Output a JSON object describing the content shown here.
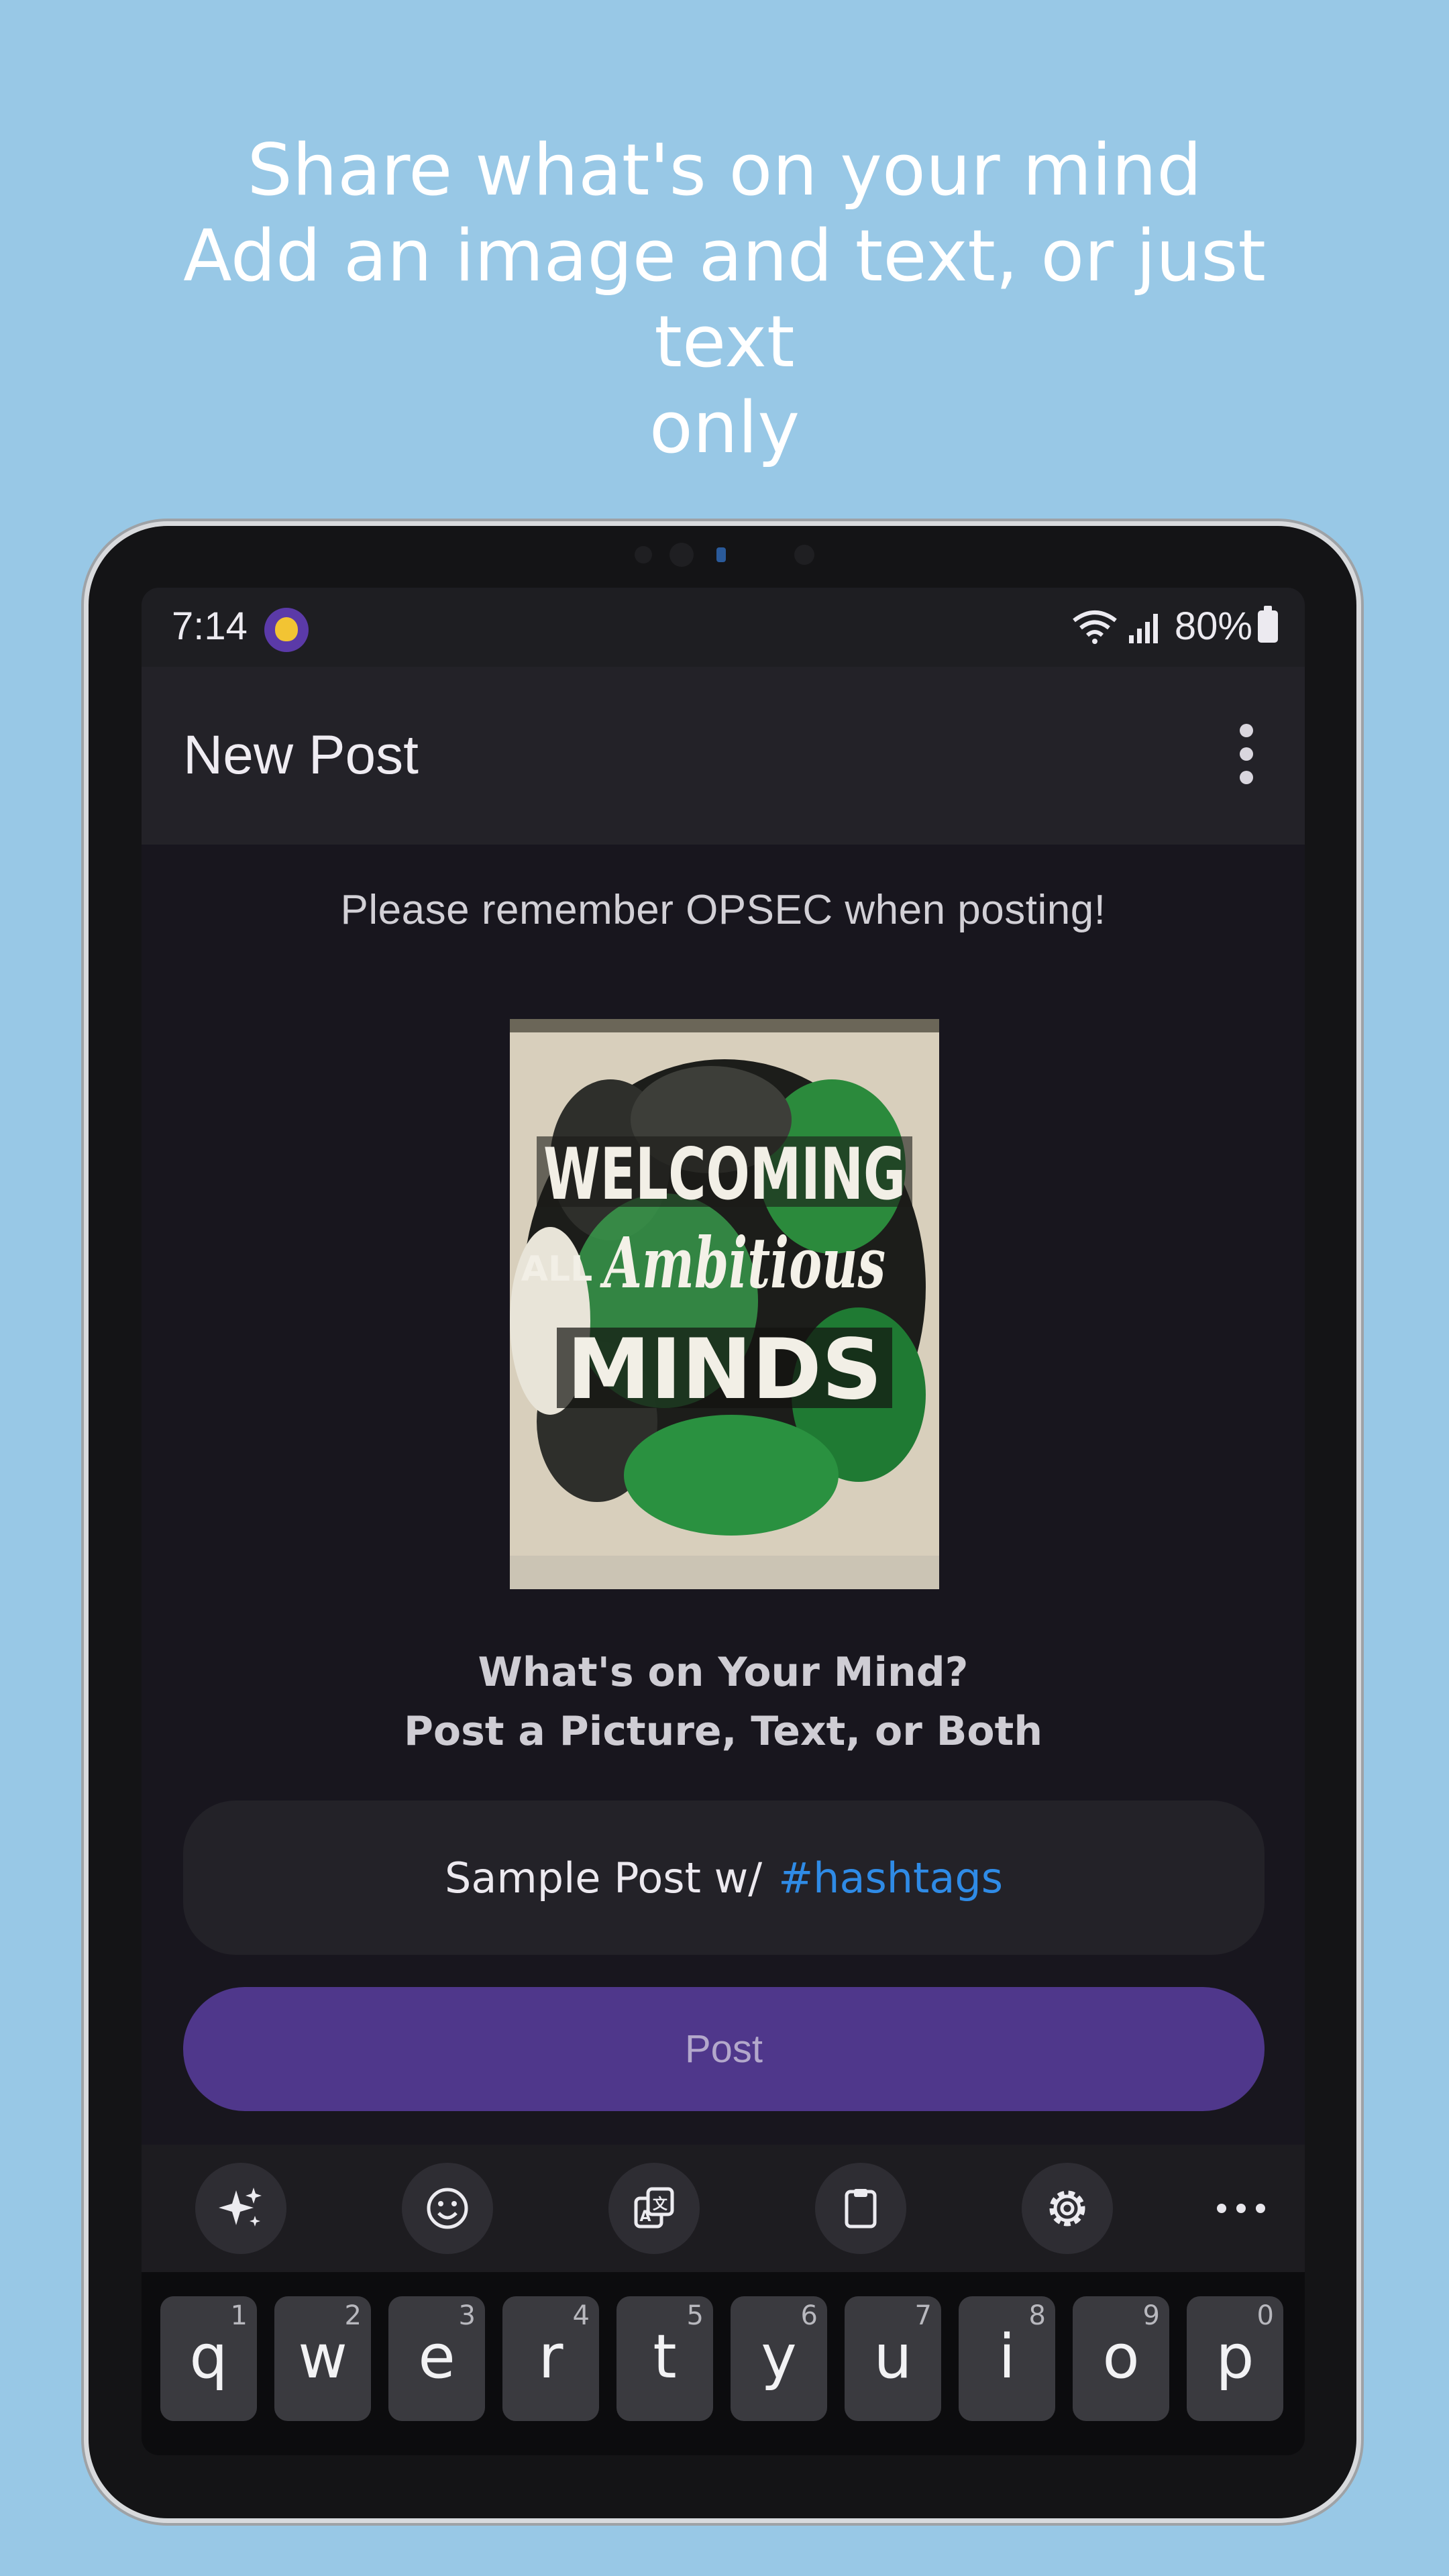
{
  "promo": {
    "line1": "Share what's on your mind",
    "line2": "Add an image and text, or just text",
    "line3": "only"
  },
  "status_bar": {
    "time": "7:14",
    "battery": "80%",
    "icons": [
      "app-badge-icon",
      "wifi-icon",
      "signal-icon",
      "battery-icon"
    ]
  },
  "app_bar": {
    "title": "New Post",
    "menu_icon": "more-vert-icon"
  },
  "notice": "Please remember OPSEC when posting!",
  "image": {
    "words": [
      "WELCOMING",
      "ALL",
      "Ambitious",
      "MINDS"
    ]
  },
  "prompt": {
    "line1": "What's on Your Mind?",
    "line2": "Post a Picture, Text, or Both"
  },
  "text_field": {
    "value": "Sample Post w/",
    "hashtag": "#hashtags"
  },
  "post_button": "Post",
  "keyboard": {
    "toolbar": [
      "sparkle-icon",
      "emoji-icon",
      "translate-icon",
      "clipboard-icon",
      "settings-icon",
      "more-horiz-icon"
    ],
    "keys": [
      {
        "letter": "q",
        "hint": "1"
      },
      {
        "letter": "w",
        "hint": "2"
      },
      {
        "letter": "e",
        "hint": "3"
      },
      {
        "letter": "r",
        "hint": "4"
      },
      {
        "letter": "t",
        "hint": "5"
      },
      {
        "letter": "y",
        "hint": "6"
      },
      {
        "letter": "u",
        "hint": "7"
      },
      {
        "letter": "i",
        "hint": "8"
      },
      {
        "letter": "o",
        "hint": "9"
      },
      {
        "letter": "p",
        "hint": "0"
      }
    ]
  },
  "colors": {
    "background": "#98c8e6",
    "accent": "#4f378b",
    "hashtag": "#2f8be6"
  }
}
